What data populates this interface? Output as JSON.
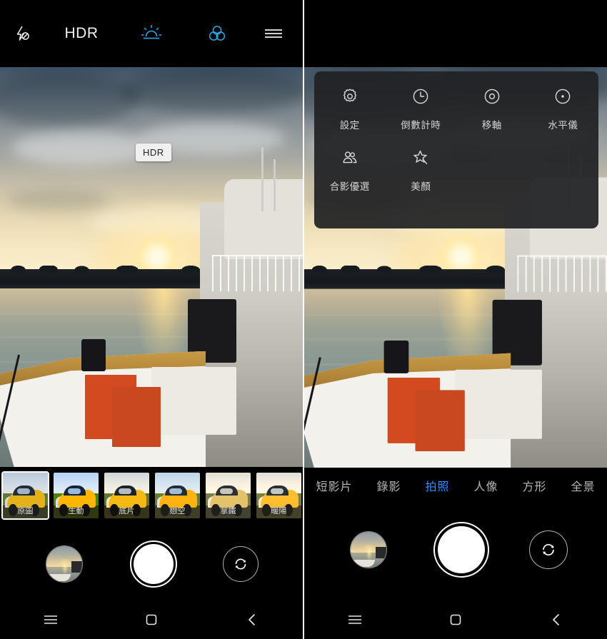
{
  "app": {
    "name": "Camera",
    "accent_blue": "#2e8fff",
    "icon_cyan": "#29a7e0",
    "overlay_bg": "#202123"
  },
  "left_panel": {
    "topbar": {
      "flash_icon": "flash-off-icon",
      "hdr_label": "HDR",
      "sunrise_icon": "sunrise-hdr-icon",
      "filter_icon": "filter-circles-icon",
      "menu_icon": "hamburger-menu-icon"
    },
    "tooltip": {
      "text": "HDR"
    },
    "filters": [
      {
        "label": "原圖",
        "selected": true,
        "fx": "fx-none"
      },
      {
        "label": "生動",
        "selected": false,
        "fx": "fx-sheng"
      },
      {
        "label": "底片",
        "selected": false,
        "fx": "fx-dipian"
      },
      {
        "label": "戀空",
        "selected": false,
        "fx": "fx-liankong"
      },
      {
        "label": "拿鐵",
        "selected": false,
        "fx": "fx-nathie"
      },
      {
        "label": "暖陽",
        "selected": false,
        "fx": "fx-nuanyang"
      },
      {
        "label": "",
        "selected": false,
        "fx": "fx-next"
      }
    ],
    "controls": {
      "gallery_thumb": "gallery-thumbnail",
      "shutter": "shutter-button",
      "flip": "switch-camera-icon"
    },
    "navbar": {
      "recents": "recents-icon",
      "home": "home-icon",
      "back": "back-icon"
    }
  },
  "right_panel": {
    "menu": {
      "items": [
        {
          "label": "設定",
          "icon": "gear-icon"
        },
        {
          "label": "倒數計時",
          "icon": "clock-icon"
        },
        {
          "label": "移軸",
          "icon": "tilt-shift-icon"
        },
        {
          "label": "水平儀",
          "icon": "level-icon"
        },
        {
          "label": "合影優選",
          "icon": "group-photo-icon"
        },
        {
          "label": "美顏",
          "icon": "beauty-wand-icon"
        }
      ]
    },
    "modes": [
      {
        "label": "短影片",
        "active": false
      },
      {
        "label": "錄影",
        "active": false
      },
      {
        "label": "拍照",
        "active": true
      },
      {
        "label": "人像",
        "active": false
      },
      {
        "label": "方形",
        "active": false
      },
      {
        "label": "全景",
        "active": false
      }
    ],
    "controls": {
      "gallery_thumb": "gallery-thumbnail",
      "shutter": "shutter-button",
      "flip": "switch-camera-icon"
    },
    "navbar": {
      "recents": "recents-icon",
      "home": "home-icon",
      "back": "back-icon"
    }
  }
}
